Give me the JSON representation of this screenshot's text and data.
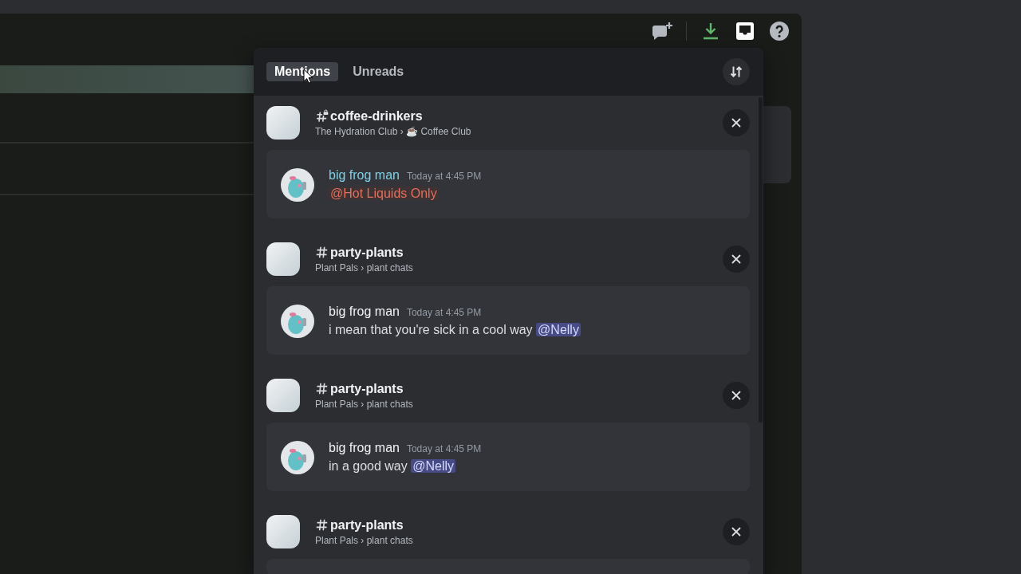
{
  "toolbar": [
    {
      "kind": "new-dm",
      "selected": false
    },
    {
      "kind": "download",
      "selected": false
    },
    {
      "kind": "inbox",
      "selected": true
    },
    {
      "kind": "help",
      "selected": false
    }
  ],
  "inbox": {
    "tabs": [
      {
        "label": "Mentions",
        "selected": true
      },
      {
        "label": "Unreads",
        "selected": false
      }
    ],
    "mentions": [
      {
        "channel": {
          "kind": "locked",
          "name": "coffee-drinkers",
          "path": "The Hydration Club › ☕ Coffee Club"
        },
        "message": {
          "author": "big frog man",
          "color": "#7fd1e6",
          "timestamp": "Today at 4:45 PM",
          "mention": {
            "kind": "role",
            "text": "@Hot Liquids Only"
          }
        }
      },
      {
        "channel": {
          "kind": "text",
          "name": "party-plants",
          "path": "Plant Pals › plant chats"
        },
        "message": {
          "author": "big frog man",
          "color": "#f2f3f5",
          "timestamp": "Today at 4:45 PM",
          "text": "i mean that you're sick in a cool way",
          "mention": {
            "kind": "user",
            "text": "@Nelly"
          }
        }
      },
      {
        "channel": {
          "kind": "text",
          "name": "party-plants",
          "path": "Plant Pals › plant chats"
        },
        "message": {
          "author": "big frog man",
          "color": "#f2f3f5",
          "timestamp": "Today at 4:45 PM",
          "text": "in a good way",
          "mention": {
            "kind": "user",
            "text": "@Nelly"
          }
        }
      },
      {
        "channel": {
          "kind": "text",
          "name": "party-plants",
          "path": "Plant Pals › plant chats"
        }
      }
    ]
  }
}
